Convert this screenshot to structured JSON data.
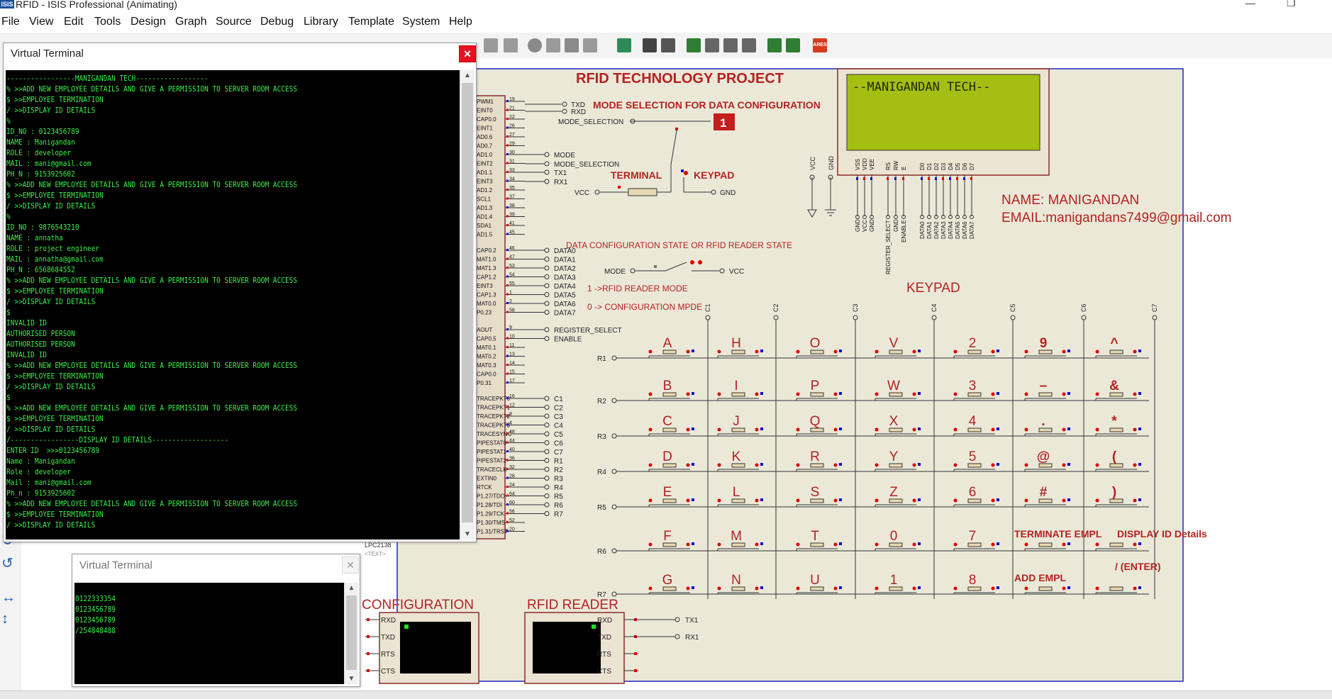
{
  "app": {
    "title": "RFID - ISIS Professional (Animating)",
    "logo_text": "ISIS",
    "min_glyph": "—",
    "max_glyph": "❐",
    "menu": [
      "File",
      "View",
      "Edit",
      "Tools",
      "Design",
      "Graph",
      "Source",
      "Debug",
      "Library",
      "Template",
      "System",
      "Help"
    ],
    "toolbar_badge": "ARES"
  },
  "terminal_main": {
    "title": "Virtual Terminal",
    "close_glyph": "✕",
    "lines": [
      "-----------------MANIGANDAN TECH------------------",
      "% >>ADD NEW EMPLOYEE DETAILS AND GIVE A PERMISSION TO SERVER ROOM ACCESS",
      "$ >>EMPLOYEE TERMINATION",
      "/ >>DISPLAY ID DETAILS",
      "%",
      "ID_NO : 0123456789",
      "NAME : Manigandan",
      "ROLE : developer",
      "MAIL : mani@gmail.com",
      "PH_N : 9153925602",
      "% >>ADD NEW EMPLOYEE DETAILS AND GIVE A PERMISSION TO SERVER ROOM ACCESS",
      "$ >>EMPLOYEE TERMINATION",
      "/ >>DISPLAY ID DETAILS",
      "%",
      "ID_NO : 9876543210",
      "NAME : annatha",
      "ROLE : project engineer",
      "MAIL : annatha@gmail.com",
      "PH_N : 6568684552",
      "% >>ADD NEW EMPLOYEE DETAILS AND GIVE A PERMISSION TO SERVER ROOM ACCESS",
      "$ >>EMPLOYEE TERMINATION",
      "/ >>DISPLAY ID DETAILS",
      "$",
      "INVALID ID",
      "AUTHORISED PERSON",
      "AUTHORISED PERSON",
      "INVALID ID",
      "% >>ADD NEW EMPLOYEE DETAILS AND GIVE A PERMISSION TO SERVER ROOM ACCESS",
      "$ >>EMPLOYEE TERMINATION",
      "/ >>DISPLAY ID DETAILS",
      "$",
      "% >>ADD NEW EMPLOYEE DETAILS AND GIVE A PERMISSION TO SERVER ROOM ACCESS",
      "$ >>EMPLOYEE TERMINATION",
      "/ >>DISPLAY ID DETAILS",
      "/-----------------DISPLAY ID DETAILS-------------------",
      "ENTER ID  >>>0123456789",
      "Name : Manigandan",
      "Role : developer",
      "Mail : mani@gmail.com",
      "Ph_n : 9153925602",
      "% >>ADD NEW EMPLOYEE DETAILS AND GIVE A PERMISSION TO SERVER ROOM ACCESS",
      "$ >>EMPLOYEE TERMINATION",
      "/ >>DISPLAY ID DETAILS"
    ]
  },
  "terminal_small": {
    "title": "Virtual Terminal",
    "close_glyph": "✕",
    "lines": [
      "0122333354",
      "0123456789",
      "0123456789",
      "/254848488"
    ]
  },
  "schematic": {
    "project_title": "RFID  TECHNOLOGY PROJECT",
    "mode_title": "MODE SELECTION FOR DATA CONFIGURATION",
    "mode_selection_label": "MODE_SELECTION",
    "switch_value": "1",
    "terminal_label": "TERMINAL",
    "keypad_label": "KEYPAD",
    "vcc": "VCC",
    "gnd": "GND",
    "txd": "TXD",
    "rxd": "RXD",
    "mode_nets": [
      "MODE",
      "MODE_SELECTION",
      "TX1",
      "RX1"
    ],
    "data_nets": [
      "DATA0",
      "DATA1",
      "DATA2",
      "DATA3",
      "DATA4",
      "DATA5",
      "DATA6",
      "DATA7"
    ],
    "reg_nets": [
      "REGISTER_SELECT",
      "ENABLE"
    ],
    "kp_nets": [
      "C1",
      "C2",
      "C3",
      "C4",
      "C5",
      "C6",
      "C7",
      "R1",
      "R2",
      "R3",
      "R4",
      "R5",
      "R6",
      "R7"
    ],
    "data_state_title": "DATA CONFIGURATION STATE OR RFID READER STATE",
    "mode": "MODE",
    "rfid_mode_text": "1 ->RFID READER MODE",
    "config_mode_text": "0 -> CONFIGURATION MPDE",
    "lcd_text": "--MANIGANDAN TECH--",
    "lcd_pins": [
      "VSS",
      "VDD",
      "VEE",
      "RS",
      "RW",
      "E",
      "D0",
      "D1",
      "D2",
      "D3",
      "D4",
      "D5",
      "D6",
      "D7"
    ],
    "lcd_nets": [
      "GND",
      "VCC",
      "GND",
      "REGISTER_SELECT",
      "GND",
      "ENABLE",
      "DATA0",
      "DATA1",
      "DATA2",
      "DATA3",
      "DATA4",
      "DATA5",
      "DATA6",
      "DATA7"
    ],
    "name_text": "NAME: MANIGANDAN",
    "email_text": "EMAIL:manigandans7499@gmail.com",
    "keypad_title": "KEYPAD",
    "columns": [
      "C1",
      "C2",
      "C3",
      "C4",
      "C5",
      "C6",
      "C7"
    ],
    "rows": [
      "R1",
      "R2",
      "R3",
      "R4",
      "R5",
      "R6",
      "R7"
    ],
    "keys": [
      [
        "A",
        "H",
        "O",
        "V",
        "2",
        "9",
        "^"
      ],
      [
        "B",
        "I",
        "P",
        "W",
        "3",
        "–",
        "&"
      ],
      [
        "C",
        "J",
        "Q",
        "X",
        "4",
        ".",
        "*"
      ],
      [
        "D",
        "K",
        "R",
        "Y",
        "5",
        "@",
        "("
      ],
      [
        "E",
        "L",
        "S",
        "Z",
        "6",
        "#",
        ")"
      ],
      [
        "F",
        "M",
        "T",
        "0",
        "7",
        "TERMINATE EMPL",
        "DISPLAY ID Details"
      ],
      [
        "G",
        "N",
        "U",
        "1",
        "8",
        "ADD EMPL",
        "/  (ENTER)"
      ]
    ],
    "mcu_name": "LPC2138",
    "mcu_sub": "<TEXT>",
    "mcu_pins_top": [
      "PWM1",
      "EINT0",
      "CAP0.0",
      "EINT1",
      "AD0.6",
      "AD0.7",
      "AD1.0",
      "EINT2",
      "AD1.1",
      "EINT3",
      "AD1.2",
      "SCL1",
      "AD1.3",
      "AD1.4",
      "SDA1",
      "AD1.5"
    ],
    "mcu_nums_top": [
      "19",
      "21",
      "22",
      "26",
      "27",
      "29",
      "30",
      "31",
      "33",
      "34",
      "35",
      "37",
      "38",
      "39",
      "41",
      "45"
    ],
    "mcu_pins_mid": [
      "CAP0.2",
      "MAT1.0",
      "MAT1.3",
      "CAP1.2",
      "EINT3",
      "CAP1.3",
      "MAT0.0",
      "P0.23"
    ],
    "mcu_nums_mid": [
      "46",
      "47",
      "53",
      "54",
      "55",
      "1",
      "2",
      "58"
    ],
    "mcu_pins_low": [
      "AOUT",
      "CAP0.5",
      "MAT0.1",
      "MAT0.2",
      "MAT0.3",
      "CAP0.0",
      "P0.31"
    ],
    "mcu_nums_low": [
      "9",
      "10",
      "11",
      "13",
      "14",
      "15",
      "17"
    ],
    "mcu_pins_bot": [
      "TRACEPKT0",
      "TRACEPKT1",
      "TRACEPKT2",
      "TRACEPKT3",
      "TRACESYNC",
      "PIPESTAT0",
      "PIPESTAT1",
      "PIPESTAT2",
      "TRACECLK",
      "EXTIN0",
      "RTCK",
      "P1.27/TDO",
      "P1.28/TDI",
      "P1.29/TCK",
      "P1.30/TMS",
      "P1.31/TRST"
    ],
    "mcu_nums_bot": [
      "16",
      "12",
      "8",
      "4",
      "48",
      "44",
      "40",
      "36",
      "32",
      "28",
      "24",
      "64",
      "60",
      "56",
      "52",
      "20"
    ],
    "config_label": "CONFIGURATION",
    "rfid_reader_label": "RFID READER",
    "uart_pins": [
      "RXD",
      "TXD",
      "RTS",
      "CTS"
    ],
    "reader_nets": [
      "TX1",
      "RX1"
    ]
  }
}
